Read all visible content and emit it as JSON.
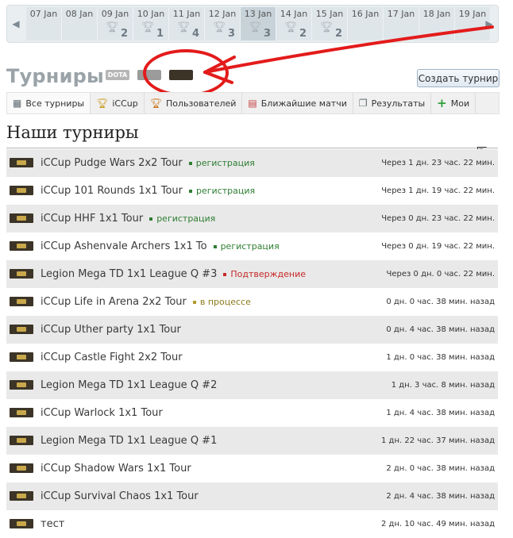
{
  "calendar": {
    "days": [
      {
        "label": "07 Jan",
        "count": ""
      },
      {
        "label": "08 Jan",
        "count": ""
      },
      {
        "label": "09 Jan",
        "count": "2"
      },
      {
        "label": "10 Jan",
        "count": "1"
      },
      {
        "label": "11 Jan",
        "count": "4"
      },
      {
        "label": "12 Jan",
        "count": "3"
      },
      {
        "label": "13 Jan",
        "count": "3"
      },
      {
        "label": "14 Jan",
        "count": "2"
      },
      {
        "label": "15 Jan",
        "count": "2"
      },
      {
        "label": "16 Jan",
        "count": ""
      },
      {
        "label": "17 Jan",
        "count": ""
      },
      {
        "label": "18 Jan",
        "count": ""
      },
      {
        "label": "19 Jan",
        "count": ""
      }
    ],
    "prev_icon": "chevron-left-icon",
    "next_icon": "chevron-right-icon"
  },
  "header": {
    "title": "Турниры",
    "games": [
      "DOTA",
      "",
      ""
    ],
    "create_button": "Создать турнир"
  },
  "tabs": [
    {
      "label": "Все турниры",
      "icon": "tournament-icon"
    },
    {
      "label": "iCCup",
      "icon": "trophy-icon"
    },
    {
      "label": "Пользователей",
      "icon": "trophy-icon"
    },
    {
      "label": "Ближайшие матчи",
      "icon": "calendar-icon"
    },
    {
      "label": "Результаты",
      "icon": "results-icon"
    },
    {
      "label": "Мои",
      "icon": "plus-icon"
    }
  ],
  "section_title": "Наши турниры",
  "tournaments": [
    {
      "name": "iCCup Pudge Wars 2x2 Tour",
      "status": "регистрация",
      "status_type": "reg",
      "time": "Через 1 дн. 23 час. 22 мин."
    },
    {
      "name": "iCCup 101 Rounds 1x1 Tour",
      "status": "регистрация",
      "status_type": "reg",
      "time": "Через 1 дн. 19 час. 22 мин."
    },
    {
      "name": "iCCup HHF 1x1 Tour",
      "status": "регистрация",
      "status_type": "reg",
      "time": "Через 0 дн. 23 час. 22 мин."
    },
    {
      "name": "iCCup Ashenvale Archers 1x1 To",
      "status": "регистрация",
      "status_type": "reg",
      "time": "Через 0 дн. 19 час. 22 мин."
    },
    {
      "name": "Legion Mega TD 1x1 League Q #3",
      "status": "Подтверждение",
      "status_type": "conf",
      "time": "Через 0 дн. 0 час. 22 мин."
    },
    {
      "name": "iCCup Life in Arena 2x2 Tour",
      "status": "в процессе",
      "status_type": "prog",
      "time": "0 дн. 0 час. 38 мин. назад"
    },
    {
      "name": "iCCup Uther party 1x1 Tour",
      "status": "",
      "status_type": "",
      "time": "0 дн. 4 час. 38 мин. назад"
    },
    {
      "name": "iCCup Castle Fight 2x2 Tour",
      "status": "",
      "status_type": "",
      "time": "1 дн. 0 час. 38 мин. назад"
    },
    {
      "name": "Legion Mega TD 1x1 League Q #2",
      "status": "",
      "status_type": "",
      "time": "1 дн. 3 час. 8 мин. назад"
    },
    {
      "name": "iCCup Warlock 1x1 Tour",
      "status": "",
      "status_type": "",
      "time": "1 дн. 4 час. 38 мин. назад"
    },
    {
      "name": "Legion Mega TD 1x1 League Q #1",
      "status": "",
      "status_type": "",
      "time": "1 дн. 22 час. 37 мин. назад"
    },
    {
      "name": "iCCup Shadow Wars 1x1 Tour",
      "status": "",
      "status_type": "",
      "time": "2 дн. 0 час. 38 мин. назад"
    },
    {
      "name": "iCCup Survival Chaos 1x1 Tour",
      "status": "",
      "status_type": "",
      "time": "2 дн. 4 час. 38 мин. назад"
    },
    {
      "name": "тест",
      "status": "",
      "status_type": "",
      "time": "2 дн. 10 час. 49 мин. назад"
    }
  ]
}
